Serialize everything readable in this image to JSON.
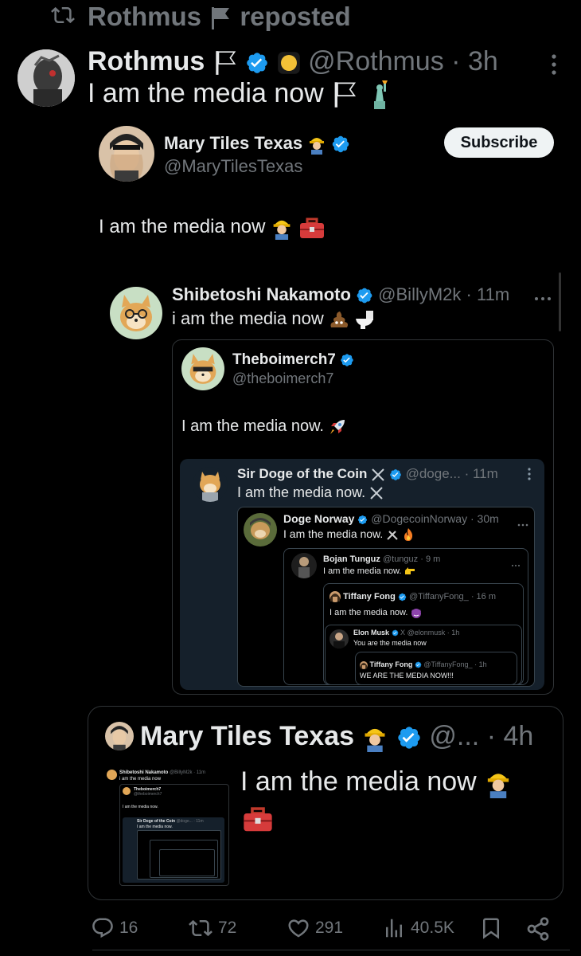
{
  "repost": {
    "user": "Rothmus",
    "label": "reposted"
  },
  "main_post": {
    "name": "Rothmus",
    "handle": "@Rothmus",
    "time": "3h",
    "text": "I am the media now"
  },
  "quote_mary": {
    "name": "Mary Tiles Texas",
    "handle": "@MaryTilesTexas",
    "subscribe": "Subscribe",
    "text": "I am the media now"
  },
  "quote_shib": {
    "name": "Shibetoshi Nakamoto",
    "handle": "@BillyM2k",
    "time": "11m",
    "text": "i am the media now"
  },
  "quote_theboi": {
    "name": "Theboimerch7",
    "handle": "@theboimerch7",
    "text": "I am the media now."
  },
  "quote_sirdoge": {
    "name": "Sir Doge of the Coin",
    "handle": "@doge...",
    "time": "11m",
    "text": "I am the media now."
  },
  "quote_dogenorway": {
    "name": "Doge Norway",
    "handle": "@DogecoinNorway",
    "time": "30m",
    "text": "I am the media now."
  },
  "quote_bojan": {
    "name": "Bojan Tunguz",
    "handle": "@tunguz",
    "time": "9 m",
    "text": "I am the media now."
  },
  "quote_tiffany": {
    "name": "Tiffany Fong",
    "handle": "@TiffanyFong_",
    "time": "16 m",
    "text": "I am the media now."
  },
  "quote_elon": {
    "name": "Elon Musk",
    "x_label": "X",
    "handle": "@elonmusk",
    "time": "1h",
    "text": "You are the media now"
  },
  "quote_tiffany2": {
    "name": "Tiffany Fong",
    "handle": "@TiffanyFong_",
    "time": "1h",
    "text": "WE ARE THE MEDIA NOW!!!"
  },
  "bottom_quote": {
    "name": "Mary Tiles Texas",
    "handle": "@...",
    "time": "4h",
    "text": "I am the media now"
  },
  "mini": {
    "shib_line": "Shibetoshi Nakamoto",
    "shib_handle": "@BillyM2k · 11m",
    "shib_text": "i am the media now",
    "theboi": "Theboimerch7",
    "theboi_handle": "@theboimerch7",
    "theboi_text": "I am the media now.",
    "sirdoge": "Sir Doge of the Coin",
    "sirdoge_handle": "@doge... · 11m",
    "sirdoge_text": "I am the media now."
  },
  "actions": {
    "replies": "16",
    "reposts": "72",
    "likes": "291",
    "views": "40.5K"
  },
  "colors": {
    "background": "#000000",
    "verified": "#1d9bf0",
    "muted": "#71767b",
    "card_blue": "#15202b"
  }
}
